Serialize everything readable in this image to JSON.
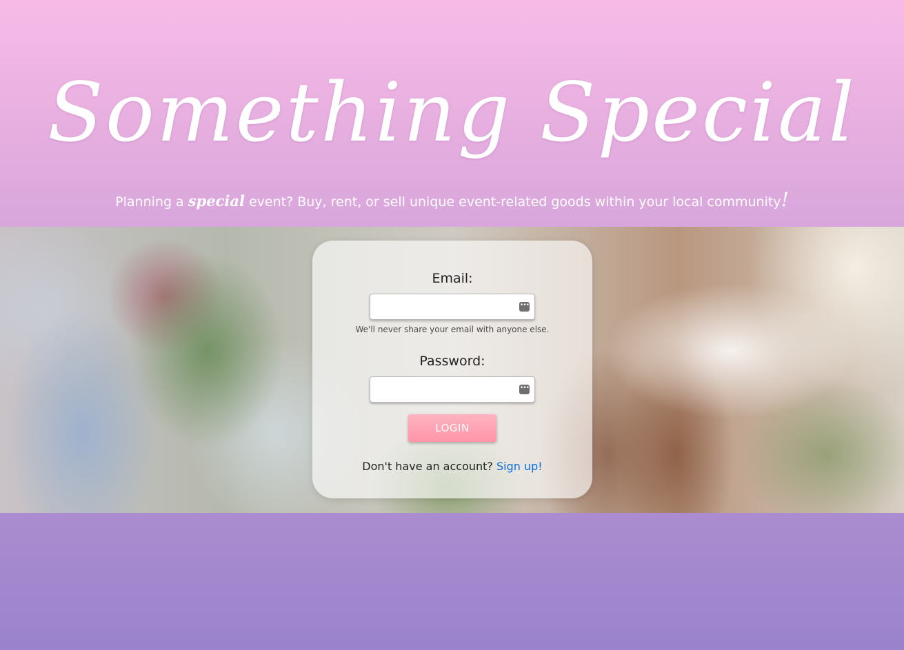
{
  "header": {
    "brand_title": "Something Special",
    "tagline_prefix": "Planning a ",
    "tagline_accent": "special",
    "tagline_suffix": " event? Buy, rent, or sell unique event-related goods within your local community",
    "tagline_accent_mark": "!"
  },
  "login_form": {
    "email_label": "Email:",
    "email_value": "",
    "email_helper": "We'll never share your email with anyone else.",
    "password_label": "Password:",
    "password_value": "",
    "autofill_icon": "key-autofill-icon",
    "autofill_glyph": "•••",
    "login_button_label": "LOGIN",
    "signup_prompt": "Don't have an account? ",
    "signup_link_text": "Sign up!"
  },
  "colors": {
    "login_button": "#ff9fb1",
    "link": "#0a6ddb",
    "header_top": "#f8bbe8",
    "page_bottom": "#9a83cc"
  }
}
